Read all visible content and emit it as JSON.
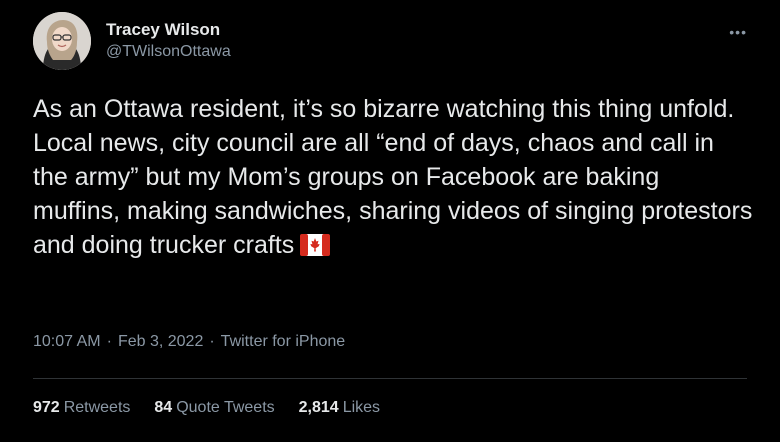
{
  "author": {
    "display_name": "Tracey Wilson",
    "handle": "@TWilsonOttawa"
  },
  "more_icon": "•••",
  "tweet": {
    "text": "As an Ottawa resident, it’s so bizarre watching this thing unfold. Local news, city council are all “end of days, chaos and call in the army” but my Mom’s groups on Facebook are baking muffins, making sandwiches, sharing videos of singing protestors and doing trucker crafts",
    "emoji": "canada-flag-icon"
  },
  "meta": {
    "time": "10:07 AM",
    "sep1": "·",
    "date": "Feb 3, 2022",
    "sep2": "·",
    "source": "Twitter for iPhone"
  },
  "stats": {
    "retweets_count": "972",
    "retweets_label": "Retweets",
    "quotes_count": "84",
    "quotes_label": "Quote Tweets",
    "likes_count": "2,814",
    "likes_label": "Likes"
  },
  "colors": {
    "background": "#000000",
    "text_primary": "#e7e9ea",
    "text_secondary": "#8b98a5",
    "divider": "#2f3336",
    "flag_red": "#d52b1e"
  }
}
